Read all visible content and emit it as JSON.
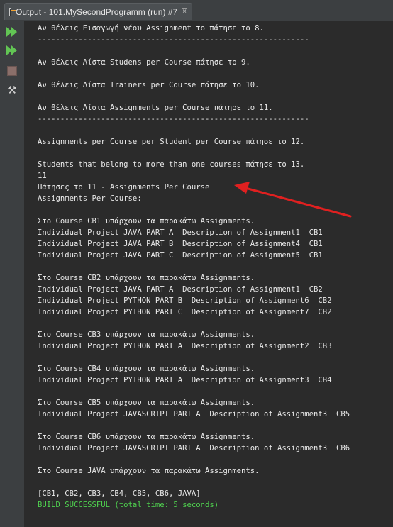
{
  "window": {
    "tab_title": "Output - 101.MySecondProgramm (run) #7",
    "close_glyph": "×"
  },
  "toolbar": {
    "icons": [
      "rerun-icon",
      "rerun-with-input-icon",
      "stop-icon",
      "settings-icon"
    ]
  },
  "console": {
    "lines": [
      "Αν θέλεις Εισαγωγή νέου Assignment το πάτησε το 8.",
      "------------------------------------------------------------",
      "",
      "Αν θέλεις Λίστα Studens per Course πάτησε το 9.",
      "",
      "Αν θέλεις Λίστα Trainers per Course πάτησε το 10.",
      "",
      "Αν θέλεις Λίστα Assignments per Course πάτησε το 11.",
      "------------------------------------------------------------",
      "",
      "Assignments per Course per Student per Course πάτησε το 12.",
      "",
      "Students that belong to more than one courses πάτησε το 13.",
      "11",
      "Πάτησες το 11 - Assignments Per Course",
      "Assignments Per Course:",
      "",
      "Στο Course CB1 υπάρχουν τα παρακάτω Assignments.",
      "Individual Project JAVA PART A  Description of Assignment1  CB1",
      "Individual Project JAVA PART B  Description of Assignment4  CB1",
      "Individual Project JAVA PART C  Description of Assignment5  CB1",
      "",
      "Στο Course CB2 υπάρχουν τα παρακάτω Assignments.",
      "Individual Project JAVA PART A  Description of Assignment1  CB2",
      "Individual Project PYTHON PART B  Description of Assignment6  CB2",
      "Individual Project PYTHON PART C  Description of Assignment7  CB2",
      "",
      "Στο Course CB3 υπάρχουν τα παρακάτω Assignments.",
      "Individual Project PYTHON PART A  Description of Assignment2  CB3",
      "",
      "Στο Course CB4 υπάρχουν τα παρακάτω Assignments.",
      "Individual Project PYTHON PART A  Description of Assignment3  CB4",
      "",
      "Στο Course CB5 υπάρχουν τα παρακάτω Assignments.",
      "Individual Project JAVASCRIPT PART A  Description of Assignment3  CB5",
      "",
      "Στο Course CB6 υπάρχουν τα παρακάτω Assignments.",
      "Individual Project JAVASCRIPT PART A  Description of Assignment3  CB6",
      "",
      "Στο Course JAVA υπάρχουν τα παρακάτω Assignments.",
      "",
      "[CB1, CB2, CB3, CB4, CB5, CB6, JAVA]",
      "BUILD SUCCESSFUL (total time: 5 seconds)"
    ],
    "success_line_index": 42
  },
  "annotation": {
    "arrow_color": "#e02020"
  }
}
